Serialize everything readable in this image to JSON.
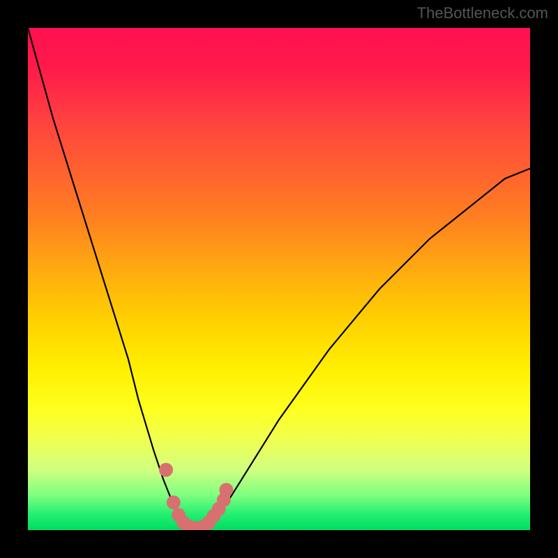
{
  "watermark": "TheBottleneck.com",
  "chart_data": {
    "type": "line",
    "title": "",
    "xlabel": "",
    "ylabel": "",
    "xlim": [
      0,
      100
    ],
    "ylim": [
      0,
      100
    ],
    "curve_main": {
      "name": "bottleneck-curve",
      "x": [
        0,
        5,
        10,
        15,
        20,
        22,
        25,
        27,
        29,
        31,
        33,
        35,
        37,
        40,
        45,
        50,
        55,
        60,
        65,
        70,
        75,
        80,
        85,
        90,
        95,
        100
      ],
      "y": [
        100,
        82,
        66,
        50,
        34,
        26,
        16,
        10,
        5,
        2,
        0,
        0,
        2,
        6,
        14,
        22,
        29,
        36,
        42,
        48,
        53,
        58,
        62,
        66,
        70,
        72
      ]
    },
    "dotted_segment": {
      "name": "minimum-markers",
      "points": [
        {
          "x": 27.5,
          "y": 12
        },
        {
          "x": 29.0,
          "y": 5.5
        },
        {
          "x": 30.0,
          "y": 3.0
        },
        {
          "x": 31.0,
          "y": 1.5
        },
        {
          "x": 32.0,
          "y": 0.7
        },
        {
          "x": 33.0,
          "y": 0.4
        },
        {
          "x": 34.0,
          "y": 0.4
        },
        {
          "x": 35.0,
          "y": 0.7
        },
        {
          "x": 36.0,
          "y": 1.5
        },
        {
          "x": 37.0,
          "y": 2.8
        },
        {
          "x": 38.0,
          "y": 4.2
        },
        {
          "x": 39.0,
          "y": 6.0
        },
        {
          "x": 39.5,
          "y": 8.0
        }
      ],
      "color": "#d87070",
      "radius": 10
    },
    "gradient_stops": [
      {
        "pos": 0.0,
        "color": "#ff1050"
      },
      {
        "pos": 0.3,
        "color": "#ff6030"
      },
      {
        "pos": 0.6,
        "color": "#ffe000"
      },
      {
        "pos": 0.85,
        "color": "#e0ff60"
      },
      {
        "pos": 1.0,
        "color": "#00dd60"
      }
    ],
    "grid": false,
    "legend": false
  }
}
